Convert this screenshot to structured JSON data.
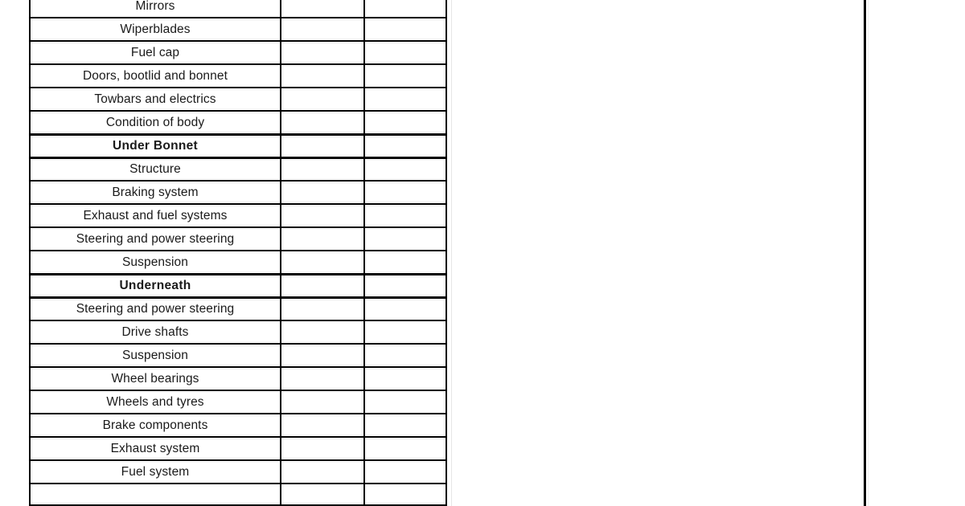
{
  "document": {
    "kind": "vehicle-inspection-checklist-table",
    "background_color": "#ffffff",
    "rule_color": "#000000",
    "text_color": "#1a1a1a",
    "faint_line_color": "#e6e6e6"
  },
  "table": {
    "columns": [
      {
        "key": "item",
        "header": "",
        "align": "center"
      },
      {
        "key": "check1",
        "header": "",
        "align": "center"
      },
      {
        "key": "check2",
        "header": "",
        "align": "center"
      }
    ],
    "rows": [
      {
        "item": "Mirrors",
        "type": "item",
        "clipped_top": true,
        "check1": "",
        "check2": ""
      },
      {
        "item": "Wiperblades",
        "type": "item",
        "check1": "",
        "check2": ""
      },
      {
        "item": "Fuel cap",
        "type": "item",
        "check1": "",
        "check2": ""
      },
      {
        "item": "Doors, bootlid and bonnet",
        "type": "item",
        "check1": "",
        "check2": ""
      },
      {
        "item": "Towbars and electrics",
        "type": "item",
        "check1": "",
        "check2": ""
      },
      {
        "item": "Condition of body",
        "type": "item",
        "check1": "",
        "check2": ""
      },
      {
        "item": "Under Bonnet",
        "type": "section",
        "check1": "",
        "check2": ""
      },
      {
        "item": "Structure",
        "type": "item",
        "check1": "",
        "check2": ""
      },
      {
        "item": "Braking system",
        "type": "item",
        "check1": "",
        "check2": ""
      },
      {
        "item": "Exhaust and fuel systems",
        "type": "item",
        "check1": "",
        "check2": ""
      },
      {
        "item": "Steering and power steering",
        "type": "item",
        "check1": "",
        "check2": ""
      },
      {
        "item": "Suspension",
        "type": "item",
        "check1": "",
        "check2": ""
      },
      {
        "item": "Underneath",
        "type": "section",
        "check1": "",
        "check2": ""
      },
      {
        "item": "Steering and power steering",
        "type": "item",
        "check1": "",
        "check2": ""
      },
      {
        "item": "Drive shafts",
        "type": "item",
        "check1": "",
        "check2": ""
      },
      {
        "item": "Suspension",
        "type": "item",
        "check1": "",
        "check2": ""
      },
      {
        "item": "Wheel bearings",
        "type": "item",
        "check1": "",
        "check2": ""
      },
      {
        "item": "Wheels and tyres",
        "type": "item",
        "check1": "",
        "check2": ""
      },
      {
        "item": "Brake components",
        "type": "item",
        "check1": "",
        "check2": ""
      },
      {
        "item": "Exhaust system",
        "type": "item",
        "check1": "",
        "check2": ""
      },
      {
        "item": "Fuel system",
        "type": "item",
        "check1": "",
        "check2": ""
      },
      {
        "item": "",
        "type": "item",
        "clipped_bottom": true,
        "check1": "",
        "check2": ""
      }
    ]
  }
}
